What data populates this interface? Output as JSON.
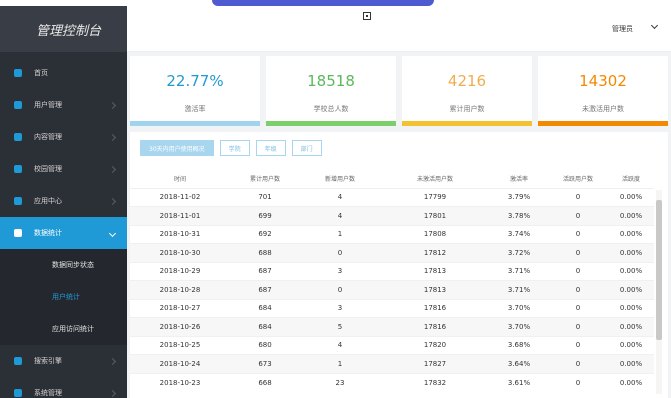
{
  "brand": "管理控制台",
  "header": {
    "user": "管理员"
  },
  "sidebar": {
    "items": [
      {
        "label": "首页",
        "icon": "home-icon"
      },
      {
        "label": "用户管理",
        "icon": "user-icon"
      },
      {
        "label": "内容管理",
        "icon": "content-icon"
      },
      {
        "label": "校园管理",
        "icon": "campus-icon"
      },
      {
        "label": "应用中心",
        "icon": "apps-icon"
      },
      {
        "label": "数据统计",
        "icon": "chart-icon"
      },
      {
        "label": "搜索引擎",
        "icon": "search-icon"
      },
      {
        "label": "系统管理",
        "icon": "gear-icon"
      }
    ],
    "sub_items": [
      {
        "label": "数据同步状态"
      },
      {
        "label": "用户统计"
      },
      {
        "label": "应用访问统计"
      }
    ]
  },
  "cards": [
    {
      "value": "22.77%",
      "label": "激活率",
      "color": "#1f9ad6",
      "bar": "#9fd3ee"
    },
    {
      "value": "18518",
      "label": "学校总人数",
      "color": "#5cb85c",
      "bar": "#7ccf6b"
    },
    {
      "value": "4216",
      "label": "累计用户数",
      "color": "#f0ad4e",
      "bar": "#f3c233"
    },
    {
      "value": "14302",
      "label": "未激活用户数",
      "color": "#f28a00",
      "bar": "#f28a00"
    }
  ],
  "tabs": [
    "30天内用户使用概况",
    "学院",
    "年级",
    "部门"
  ],
  "table": {
    "headers": [
      "时间",
      "累计用户数",
      "新增用户数",
      "未激活用户数",
      "激活率",
      "活跃用户数",
      "活跃度"
    ],
    "rows": [
      [
        "2018-11-02",
        "701",
        "4",
        "17799",
        "3.79%",
        "0",
        "0.00%"
      ],
      [
        "2018-11-01",
        "699",
        "4",
        "17801",
        "3.78%",
        "0",
        "0.00%"
      ],
      [
        "2018-10-31",
        "692",
        "1",
        "17808",
        "3.74%",
        "0",
        "0.00%"
      ],
      [
        "2018-10-30",
        "688",
        "0",
        "17812",
        "3.72%",
        "0",
        "0.00%"
      ],
      [
        "2018-10-29",
        "687",
        "3",
        "17813",
        "3.71%",
        "0",
        "0.00%"
      ],
      [
        "2018-10-28",
        "687",
        "0",
        "17813",
        "3.71%",
        "0",
        "0.00%"
      ],
      [
        "2018-10-27",
        "684",
        "3",
        "17816",
        "3.70%",
        "0",
        "0.00%"
      ],
      [
        "2018-10-26",
        "684",
        "5",
        "17816",
        "3.70%",
        "0",
        "0.00%"
      ],
      [
        "2018-10-25",
        "680",
        "4",
        "17820",
        "3.68%",
        "0",
        "0.00%"
      ],
      [
        "2018-10-24",
        "673",
        "1",
        "17827",
        "3.64%",
        "0",
        "0.00%"
      ],
      [
        "2018-10-23",
        "668",
        "23",
        "17832",
        "3.61%",
        "0",
        "0.00%"
      ]
    ]
  }
}
